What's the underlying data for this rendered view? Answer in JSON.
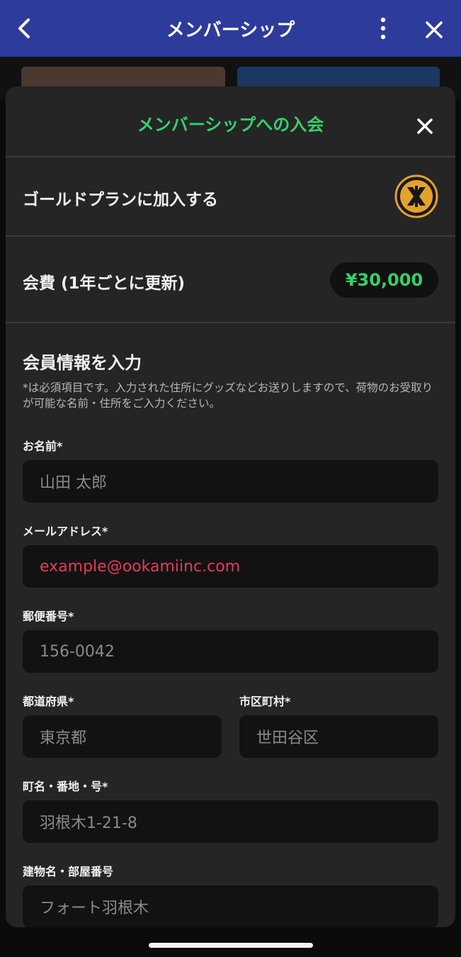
{
  "topbar": {
    "title": "メンバーシップ",
    "icons": {
      "back": "chevron-left-icon",
      "more": "more-vertical-icon",
      "close": "close-icon"
    }
  },
  "sheet": {
    "title": "メンバーシップへの入会",
    "plan_label": "ゴールドプランに加入する",
    "fee_label": "会費 (1年ごとに更新)",
    "fee_price": "¥30,000"
  },
  "form": {
    "section_title": "会員情報を入力",
    "note": "*は必須項目です。入力された住所にグッズなどお送りしますので、荷物のお受取りが可能な名前・住所をご入力ください。",
    "fields": {
      "name": {
        "label": "お名前*",
        "value": "山田 太郎"
      },
      "email": {
        "label": "メールアドレス*",
        "value": "example@ookamiinc.com"
      },
      "postal": {
        "label": "郵便番号*",
        "value": "156-0042"
      },
      "prefecture": {
        "label": "都道府県*",
        "value": "東京都"
      },
      "city": {
        "label": "市区町村*",
        "value": "世田谷区"
      },
      "street": {
        "label": "町名・番地・号*",
        "value": "羽根木1-21-8"
      },
      "building": {
        "label": "建物名・部屋番号",
        "value": "フォート羽根木"
      }
    }
  },
  "colors": {
    "accent_green": "#35d06a",
    "error_red": "#e8385a",
    "topbar_blue": "#2d3b9b",
    "sheet_bg": "#252526"
  }
}
